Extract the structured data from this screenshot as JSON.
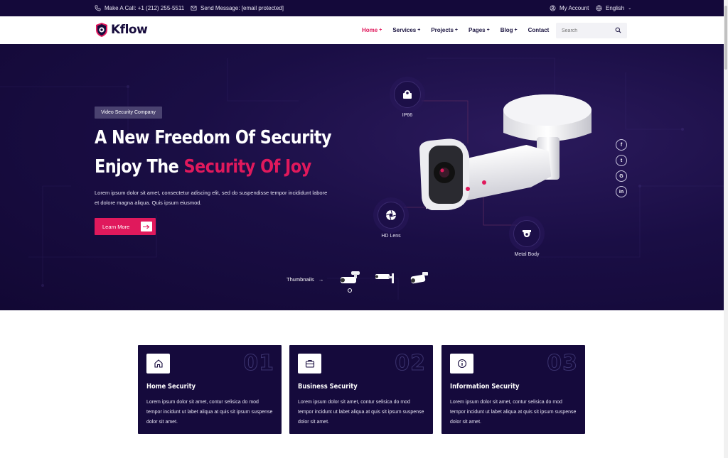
{
  "topbar": {
    "phone_text": "Make A Call: +1 (212) 255-5511",
    "email_text": "Send Message: [email protected]",
    "account_text": "My Account",
    "language_text": "English"
  },
  "header": {
    "logo_text": "Kflow",
    "nav": [
      {
        "label": "Home",
        "active": true
      },
      {
        "label": "Services",
        "active": false
      },
      {
        "label": "Projects",
        "active": false
      },
      {
        "label": "Pages",
        "active": false
      },
      {
        "label": "Blog",
        "active": false
      },
      {
        "label": "Contact",
        "active": false
      }
    ],
    "search_placeholder": "Search"
  },
  "hero": {
    "badge": "Video Security Company",
    "title_line1": "A New Freedom Of Security",
    "title_line2_plain": "Enjoy The ",
    "title_line2_accent": "Security Of Joy",
    "description": "Lorem ipsum dolor sit amet, consectetur adiscing elit, sed do suspendisse tempor incididunt labore et dolore magna aliqua. Quis ipsum eiusmod.",
    "button_label": "Learn More",
    "features": [
      "IP66",
      "HD Lens",
      "Metal Body"
    ],
    "social": [
      "f",
      "t",
      "G",
      "in"
    ],
    "thumbnails_label": "Thumbnails"
  },
  "cards": [
    {
      "number": "01",
      "title": "Home Security",
      "text": "Lorem ipsum dolor sit amet, contur selisica do mod tempor incidunt ut labet aliqua at quis sit ipsum suspense dolor sit amet.",
      "icon": "home-icon"
    },
    {
      "number": "02",
      "title": "Business Security",
      "text": "Lorem ipsum dolor sit amet, contur selisica do mod tempor incidunt ut labet aliqua at quis sit ipsum suspense dolor sit amet.",
      "icon": "briefcase-icon"
    },
    {
      "number": "03",
      "title": "Information Security",
      "text": "Lorem ipsum dolor sit amet, contur selisica do mod tempor incidunt ut labet aliqua at quis sit ipsum suspense dolor sit amet.",
      "icon": "info-icon"
    }
  ],
  "colors": {
    "brand_dark": "#14093a",
    "accent": "#e0195c"
  }
}
